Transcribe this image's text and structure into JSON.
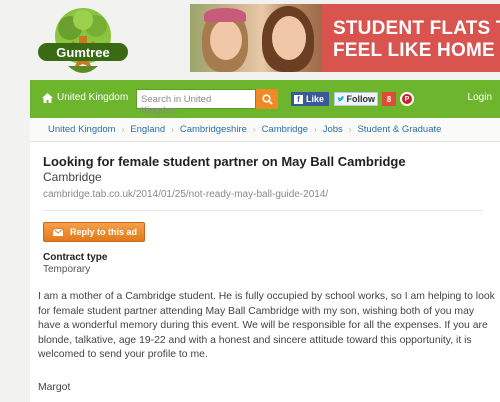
{
  "logo": {
    "text": "Gumtree"
  },
  "banner": {
    "line1": "STUDENT FLATS THA",
    "line2": "FEEL LIKE HOME"
  },
  "nav": {
    "home": "United Kingdom",
    "search_placeholder": "Search in United Kingdom",
    "fb_like": "Like",
    "tw_follow": "Follow",
    "gplus": "8",
    "login": "Login"
  },
  "breadcrumb": [
    "United Kingdom",
    "England",
    "Cambridgeshire",
    "Cambridge",
    "Jobs",
    "Student & Graduate"
  ],
  "ad": {
    "title": "Looking for female student partner on May Ball Cambridge",
    "location": "Cambridge",
    "url": "cambridge.tab.co.uk/2014/01/25/not-ready-may-ball-guide-2014/",
    "reply": "Reply to this ad",
    "contract_label": "Contract type",
    "contract_value": "Temporary",
    "description": "I am a mother of a Cambridge student. He is fully occupied by school works, so I am helping to look for female student partner attending May Ball Cambridge with my son, wishing both of you may have a wonderful memory during this event. We will be responsible for all the expenses. If you are blonde, talkative, age 19-22 and with a honest and sincere attitude toward this opportunity, it is welcomed to send your profile to me.",
    "signature": "Margot"
  },
  "colors": {
    "nav_green": "#6cb52d",
    "banner_red": "#d9534f",
    "reply_orange": "#e8842a"
  }
}
